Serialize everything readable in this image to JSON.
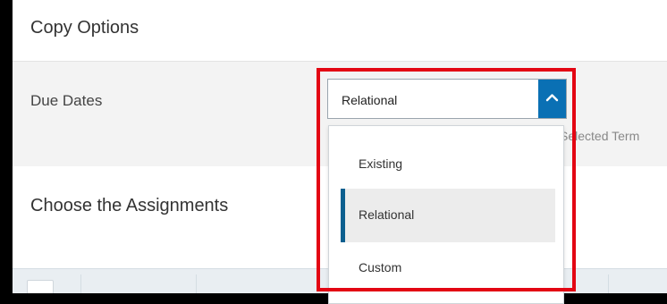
{
  "copy_options": {
    "title": "Copy Options"
  },
  "due_dates": {
    "label": "Due Dates",
    "selected_value": "Relational",
    "note_partial": "Selected Term",
    "options": [
      {
        "label": "Existing",
        "selected": false
      },
      {
        "label": "Relational",
        "selected": true
      },
      {
        "label": "Custom",
        "selected": false
      }
    ]
  },
  "assignments": {
    "title": "Choose the Assignments"
  },
  "colors": {
    "accent": "#0a70b4",
    "selected_indicator": "#0b5f8f",
    "highlight": "#e30613"
  },
  "icons": {
    "toggle": "chevron-up-icon"
  }
}
